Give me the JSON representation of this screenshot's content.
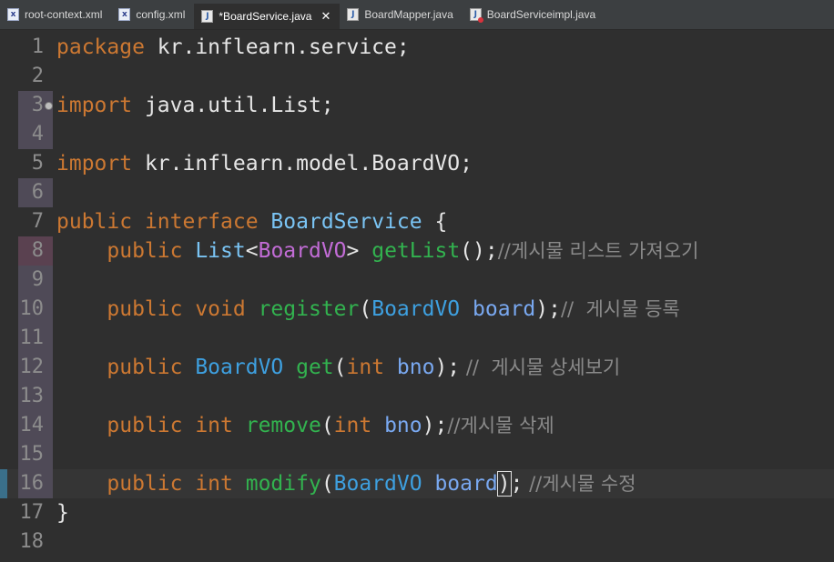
{
  "tabs": [
    {
      "label": "root-context.xml",
      "icon": "xml-file-icon",
      "active": false
    },
    {
      "label": "config.xml",
      "icon": "xml-file-icon",
      "active": false
    },
    {
      "label": "*BoardService.java",
      "icon": "java-file-icon",
      "active": true
    },
    {
      "label": "BoardMapper.java",
      "icon": "java-file-icon",
      "active": false
    },
    {
      "label": "BoardServiceimpl.java",
      "icon": "java-error-file-icon",
      "active": false
    }
  ],
  "editor": {
    "line_numbers": [
      "1",
      "2",
      "3",
      "4",
      "5",
      "6",
      "7",
      "8",
      "9",
      "10",
      "11",
      "12",
      "13",
      "14",
      "15",
      "16",
      "17",
      "18"
    ],
    "lines": {
      "l1": {
        "kw": "package",
        "rest": " kr.inflearn.service;"
      },
      "l3": {
        "kw": "import",
        "rest": " java.util.List;"
      },
      "l5": {
        "kw": "import",
        "rest": " kr.inflearn.model.BoardVO;"
      },
      "l7": {
        "kw1": "public",
        "kw2": " interface",
        "name": " BoardService",
        "brace": " {"
      },
      "l8": {
        "indent": "    ",
        "kw": "public",
        "type": " List",
        "lt": "<",
        "generic": "BoardVO",
        "gt": ">",
        "method": " getList",
        "args": "();",
        "comment": "//게시물 리스트 가져오기"
      },
      "l10": {
        "indent": "    ",
        "kw1": "public",
        "kw2": " void",
        "method": " register",
        "open": "(",
        "type": "BoardVO",
        "param": " board",
        "close": ");",
        "comment": "//  게시물 등록"
      },
      "l12": {
        "indent": "    ",
        "kw": "public",
        "type": " BoardVO",
        "method": " get",
        "open": "(",
        "ptype": "int",
        "param": " bno",
        "close": ");",
        "comment": " //  게시물 상세보기"
      },
      "l14": {
        "indent": "    ",
        "kw1": "public",
        "kw2": " int",
        "method": " remove",
        "open": "(",
        "ptype": "int",
        "param": " bno",
        "close": ");",
        "comment": "//게시물 삭제"
      },
      "l16": {
        "indent": "    ",
        "kw1": "public",
        "kw2": " int",
        "method": " modify",
        "open": "(",
        "type": "BoardVO",
        "param": " board",
        "close1": ")",
        "close2": ";",
        "comment": " //게시물 수정"
      },
      "l17": {
        "brace": "}"
      }
    }
  },
  "colors": {
    "background": "#2f2f2f",
    "keyword": "#cc7832",
    "type": "#3ea0e0",
    "method": "#32b34f",
    "param": "#79a8f0",
    "generic": "#c26cd6",
    "comment": "#8a8a8a",
    "line_number": "#8c8c8c"
  }
}
